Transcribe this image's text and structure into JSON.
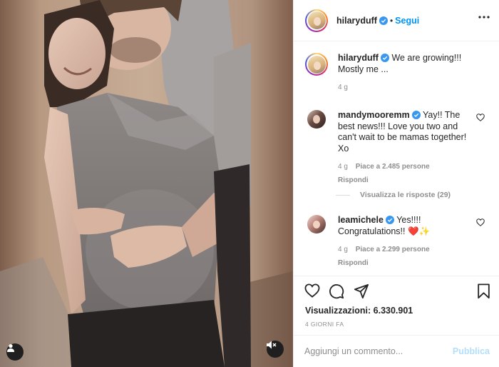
{
  "header": {
    "username": "hilaryduff",
    "separator": "•",
    "follow_label": "Segui"
  },
  "caption": {
    "username": "hilaryduff",
    "text": "We are growing!!! Mostly me ...",
    "time": "4 g"
  },
  "comments": [
    {
      "username": "mandymooremm",
      "text": "Yay!! The best news!!! Love you two and can't wait to be mamas together! Xo",
      "time": "4 g",
      "likes": "Piace a 2.485 persone",
      "reply_label": "Rispondi",
      "view_replies": "Visualizza le risposte (29)"
    },
    {
      "username": "leamichele",
      "text": "Yes!!!! Congratulations!!",
      "emojis": "❤️✨",
      "time": "4 g",
      "likes": "Piace a 2.299 persone",
      "reply_label": "Rispondi"
    }
  ],
  "stats": {
    "views_label": "Visualizzazioni:",
    "views_count": "6.330.901",
    "posted_ago": "4 GIORNI FA"
  },
  "composer": {
    "placeholder": "Aggiungi un commento...",
    "post_label": "Pubblica"
  },
  "colors": {
    "accent": "#0095f6",
    "verified": "#3897f0",
    "post_disabled": "#b2dffc",
    "emoji_heart": "#e0245e"
  },
  "icons": [
    "heart-icon",
    "comment-icon",
    "share-icon",
    "save-icon",
    "more-icon",
    "verified-icon",
    "user-tag-icon",
    "mute-icon"
  ]
}
